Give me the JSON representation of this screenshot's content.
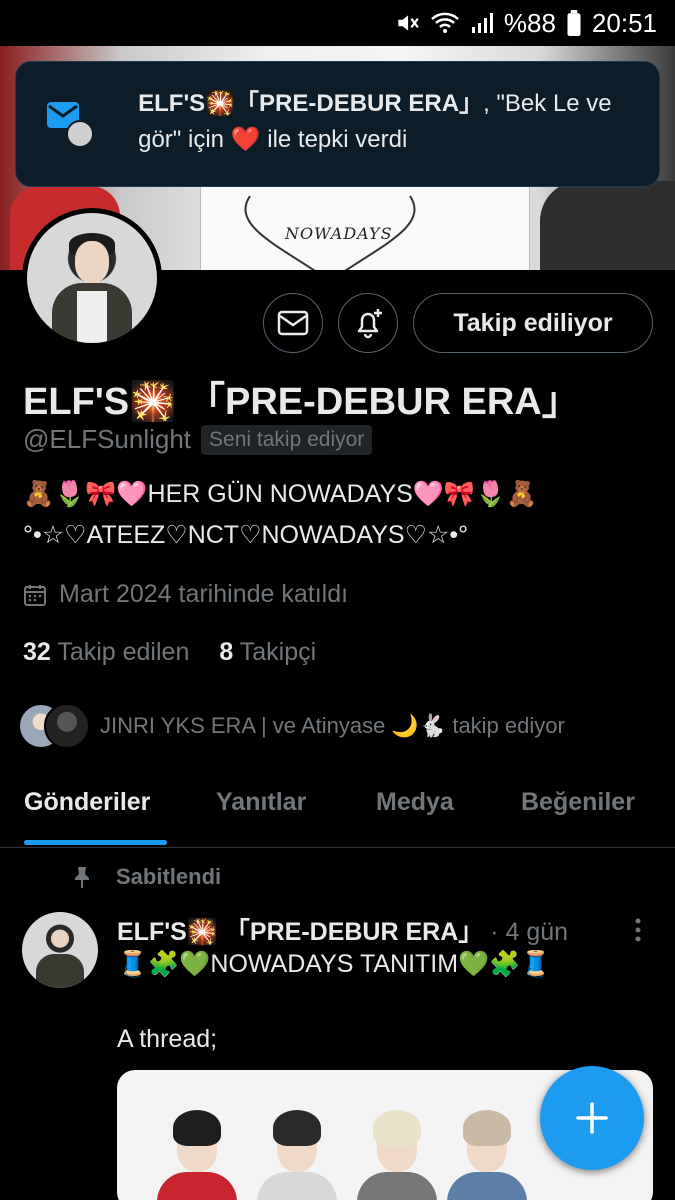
{
  "status_bar": {
    "battery": "%88",
    "time": "20:51",
    "icons": [
      "mute-icon",
      "wifi-icon",
      "signal-icon",
      "battery-icon"
    ]
  },
  "notification": {
    "icon": "mail-icon",
    "name": "ELF'S🎇「PRE-DEBUR ERA」",
    "text_before": ", \"Bek Le ve gör\" için ",
    "reaction": "❤️",
    "text_after": " ile tepki verdi"
  },
  "profile": {
    "display_name": "ELF'S🎇 「PRE-DEBUR ERA」",
    "handle": "@ELFSunlight",
    "follows_you": "Seni takip ediyor",
    "bio_line1": "🧸🌷🎀🩷HER GÜN NOWADAYS🩷🎀🌷🧸",
    "bio_line2": "°•☆♡ATEEZ♡NCT♡NOWADAYS♡☆•°",
    "joined": "Mart 2024 tarihinde katıldı",
    "following_count": "32",
    "following_label": "Takip edilen",
    "followers_count": "8",
    "followers_label": "Takipçi",
    "mutuals_text": "JINRI YKS ERA | ve Atinyase 🌙🐇 takip ediyor"
  },
  "buttons": {
    "following": "Takip ediliyor"
  },
  "tabs": [
    {
      "label": "Gönderiler",
      "active": true
    },
    {
      "label": "Yanıtlar",
      "active": false
    },
    {
      "label": "Medya",
      "active": false
    },
    {
      "label": "Beğeniler",
      "active": false
    }
  ],
  "post": {
    "pinned_label": "Sabitlendi",
    "author": "ELF'S🎇 「PRE-DEBUR ERA」",
    "time": " · 4 gün",
    "line1": "🧵🧩💚NOWADAYS TANITIM💚🧩🧵",
    "line2": "A thread;"
  },
  "colors": {
    "accent": "#1d9bf0",
    "text": "#e7e9ea",
    "secondary": "#71767b",
    "heart": "#f91880"
  }
}
